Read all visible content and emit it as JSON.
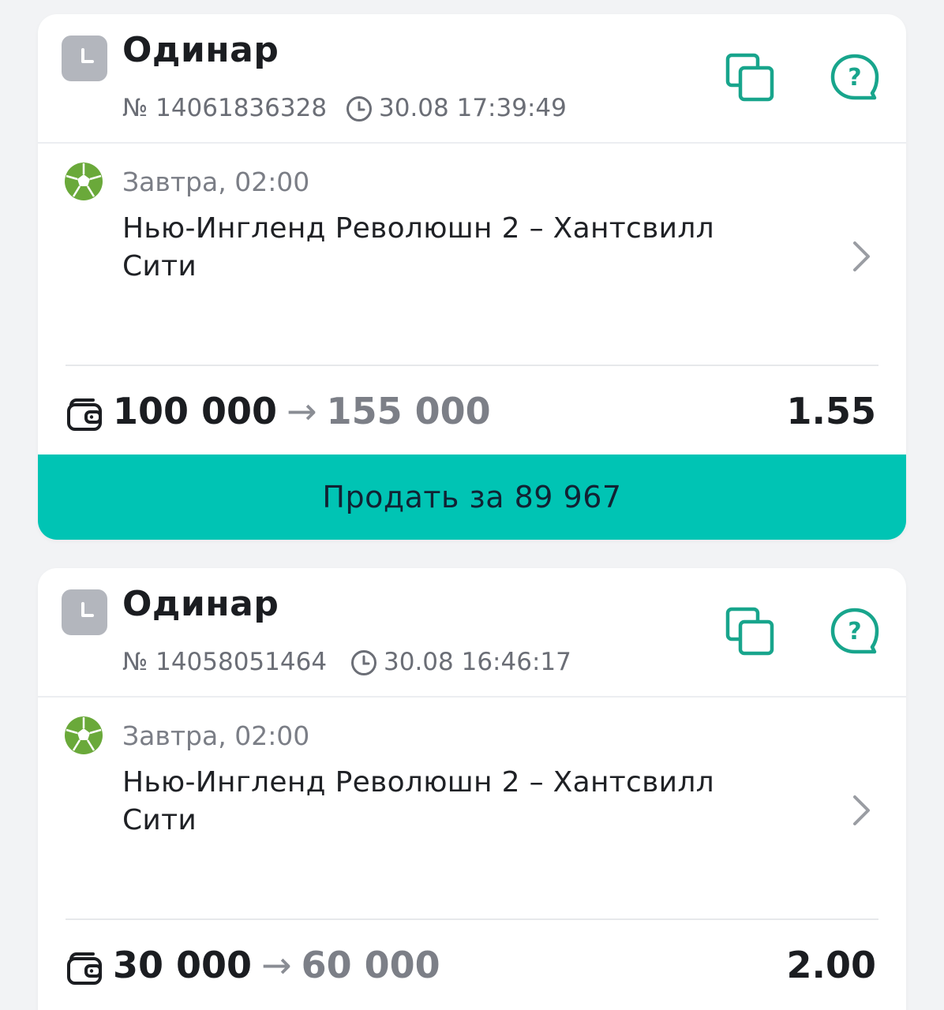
{
  "colors": {
    "accent": "#00c4b4",
    "icon_green": "#18a58c",
    "sport_green": "#6aa93a"
  },
  "bets": [
    {
      "type": "Одинар",
      "number": "№ 14061836328",
      "time": "30.08 17:39:49",
      "event_date": "Завтра, 02:00",
      "event_name": "Нью-Ингленд Революшн 2 – Хантсвилл Сити",
      "stake": "100 000",
      "arrow": "→",
      "win": "155 000",
      "coef": "1.55",
      "sell_label": "Продать за 89 967"
    },
    {
      "type": "Одинар",
      "number": "№ 14058051464",
      "time": "30.08 16:46:17",
      "event_date": "Завтра, 02:00",
      "event_name": "Нью-Ингленд Революшн 2 – Хантсвилл Сити",
      "stake": "30 000",
      "arrow": "→",
      "win": "60 000",
      "coef": "2.00"
    }
  ],
  "icons": {
    "type": "clock-icon",
    "copy": "copy-icon",
    "help": "help-bubble-icon",
    "sport": "football-icon",
    "wallet": "wallet-icon",
    "chevron": "chevron-right-icon"
  }
}
